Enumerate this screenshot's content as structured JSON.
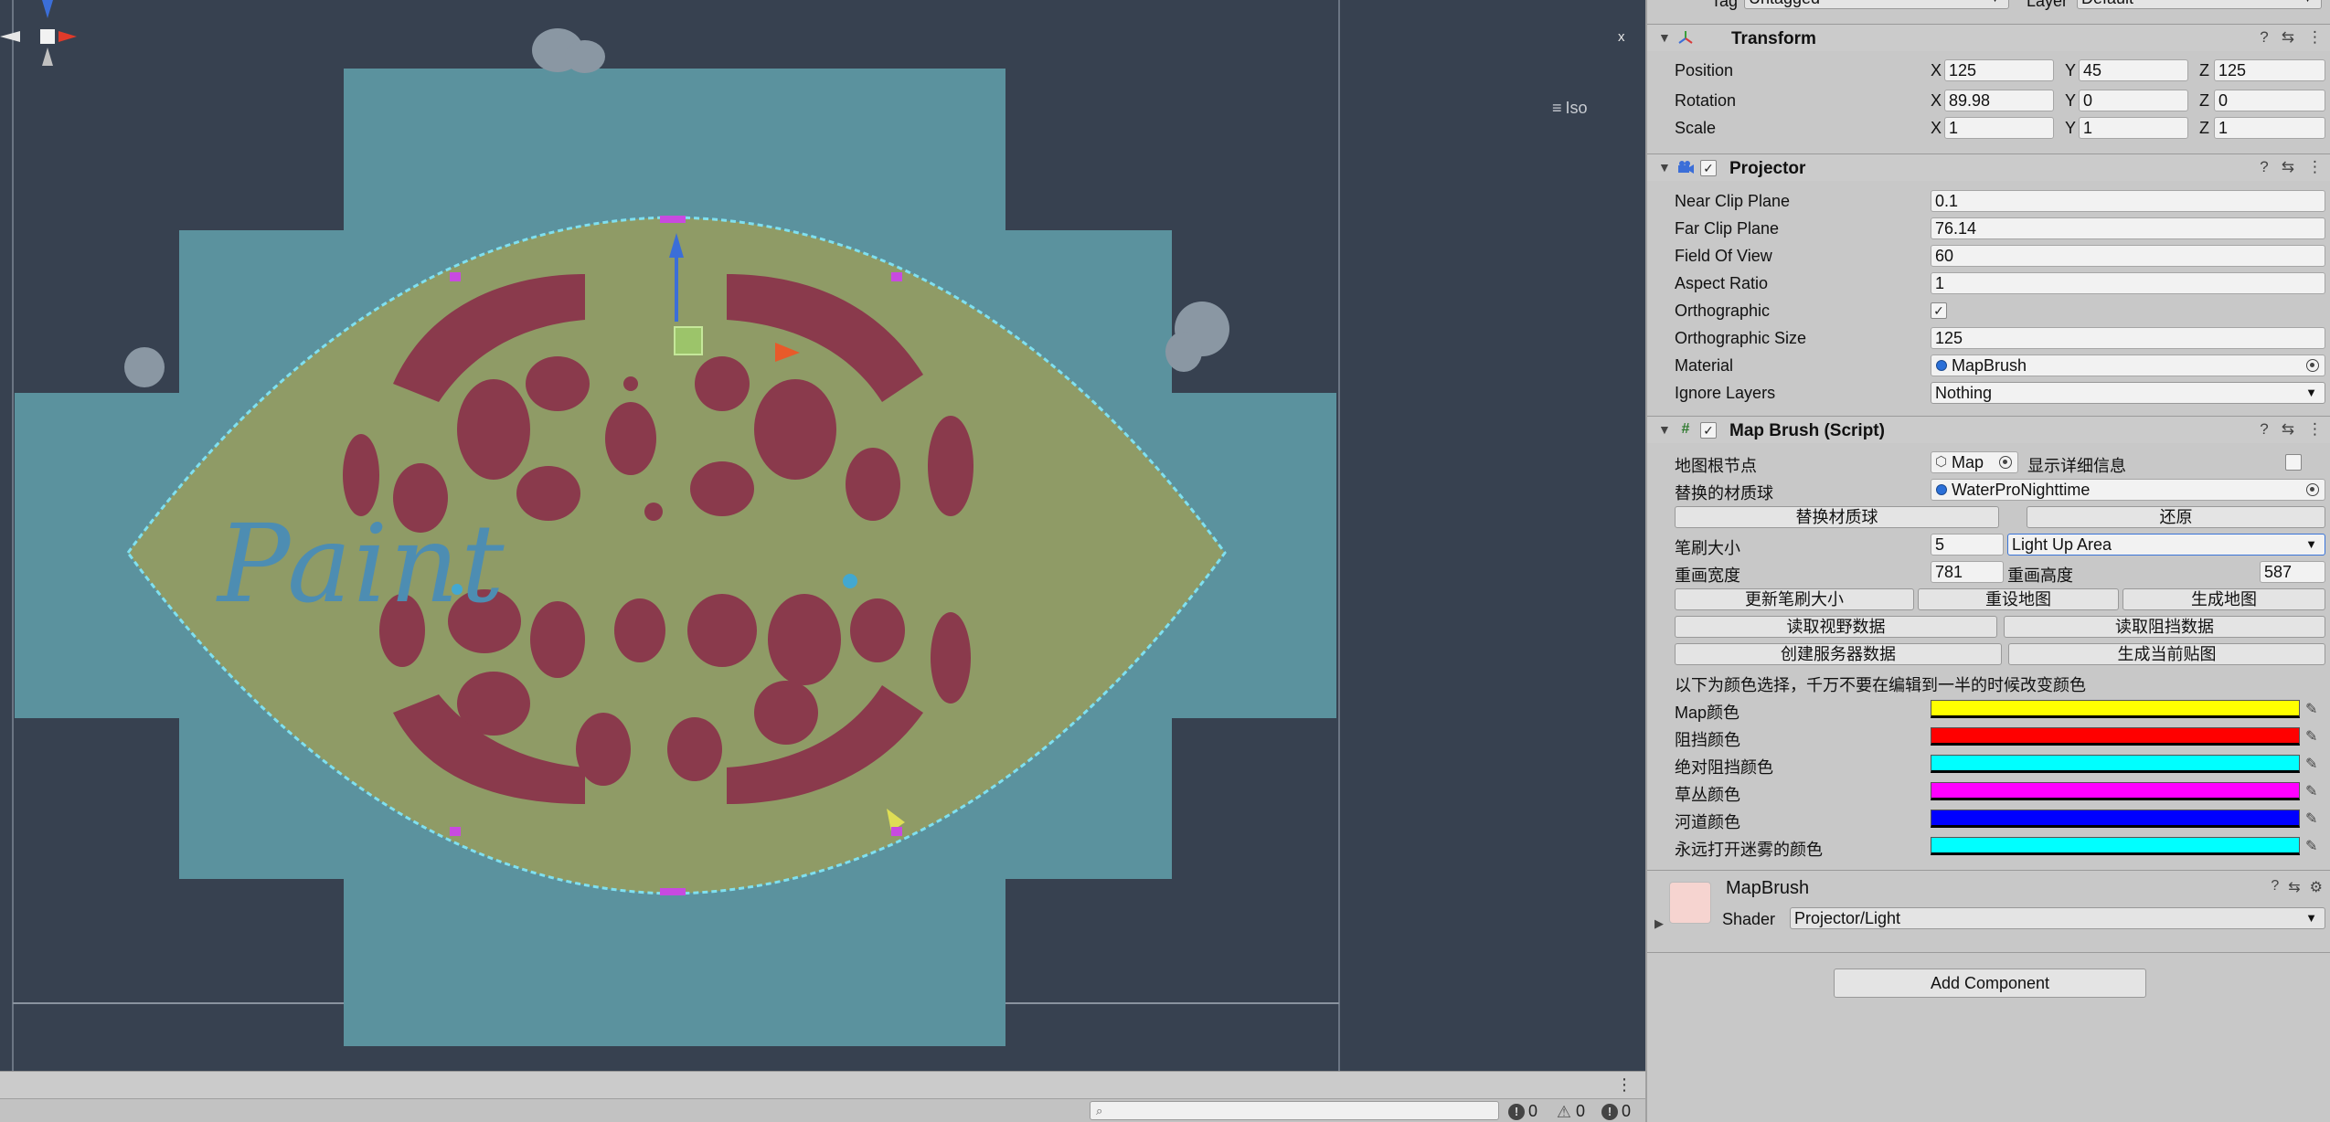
{
  "scene": {
    "iso_label": "Iso",
    "paint_text": "Paint",
    "gizmo_x_label": "x"
  },
  "inspector": {
    "top_row": {
      "tag_label": "Tag",
      "tag_value": "Untagged",
      "layer_label": "Layer",
      "layer_value": "Default"
    },
    "transform": {
      "title": "Transform",
      "position": {
        "label": "Position",
        "x": "125",
        "y": "45",
        "z": "125"
      },
      "rotation": {
        "label": "Rotation",
        "x": "89.98",
        "y": "0",
        "z": "0"
      },
      "scale": {
        "label": "Scale",
        "x": "1",
        "y": "1",
        "z": "1"
      }
    },
    "projector": {
      "title": "Projector",
      "near_clip": {
        "label": "Near Clip Plane",
        "value": "0.1"
      },
      "far_clip": {
        "label": "Far Clip Plane",
        "value": "76.14"
      },
      "fov": {
        "label": "Field Of View",
        "value": "60"
      },
      "aspect": {
        "label": "Aspect Ratio",
        "value": "1"
      },
      "orthographic": {
        "label": "Orthographic",
        "checked": true
      },
      "ortho_size": {
        "label": "Orthographic Size",
        "value": "125"
      },
      "material": {
        "label": "Material",
        "value": "MapBrush"
      },
      "ignore_layers": {
        "label": "Ignore Layers",
        "value": "Nothing"
      }
    },
    "map_brush": {
      "title": "Map Brush (Script)",
      "map_root": {
        "label": "地图根节点",
        "value": "Map",
        "detail_label": "显示详细信息"
      },
      "replace_material": {
        "label": "替换的材质球",
        "value": "WaterProNighttime"
      },
      "buttons": {
        "replace": "替换材质球",
        "restore": "还原",
        "update_brush": "更新笔刷大小",
        "reset_map": "重设地图",
        "gen_map": "生成地图",
        "read_view": "读取视野数据",
        "read_block": "读取阻挡数据",
        "create_server": "创建服务器数据",
        "gen_current": "生成当前贴图"
      },
      "brush_size": {
        "label": "笔刷大小",
        "value": "5",
        "mode": "Light Up Area"
      },
      "redraw": {
        "width_label": "重画宽度",
        "width": "781",
        "height_label": "重画高度",
        "height": "587"
      },
      "warning": "以下为颜色选择，千万不要在编辑到一半的时候改变颜色",
      "colors": [
        {
          "label": "Map颜色",
          "color": "#ffff00"
        },
        {
          "label": "阻挡颜色",
          "color": "#ff0000"
        },
        {
          "label": "绝对阻挡颜色",
          "color": "#00ffff"
        },
        {
          "label": "草丛颜色",
          "color": "#ff00ff"
        },
        {
          "label": "河道颜色",
          "color": "#0000ff"
        },
        {
          "label": "永远打开迷雾的颜色",
          "color": "#00ffff"
        }
      ]
    },
    "material_block": {
      "name": "MapBrush",
      "shader_label": "Shader",
      "shader_value": "Projector/Light"
    },
    "add_component": "Add Component"
  },
  "status": {
    "search_placeholder": "",
    "errors": "0",
    "warnings": "0",
    "infos": "0"
  }
}
